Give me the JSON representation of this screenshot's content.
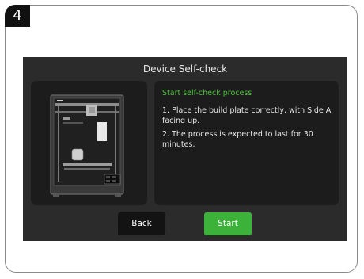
{
  "step": {
    "number": "4"
  },
  "screen": {
    "title": "Device Self-check",
    "heading": "Start self-check process",
    "steps": [
      "1. Place the build plate correctly, with Side A facing up.",
      "2. The process is expected to last for 30 minutes."
    ],
    "buttons": {
      "back": "Back",
      "start": "Start"
    }
  },
  "colors": {
    "accent": "#3db23a",
    "heading_green": "#4bc53a",
    "screen_bg": "#2b2b2b",
    "panel_bg": "#1c1c1c"
  },
  "image": {
    "icon": "printer-image"
  }
}
